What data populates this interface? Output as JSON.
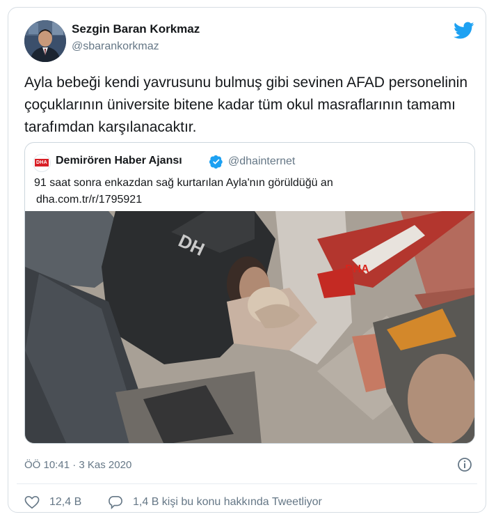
{
  "author": {
    "name": "Sezgin Baran Korkmaz",
    "handle": "@sbarankorkmaz"
  },
  "tweet": {
    "text": "Ayla bebeği kendi yavrusunu bulmuş gibi sevinen AFAD personelinin çoçuklarının üniversite bitene kadar tüm okul masraflarının tamamı tarafımdan karşılanacaktır."
  },
  "quoted": {
    "name": "Demirören Haber Ajansı",
    "handle": "@dhainternet",
    "logo_text": "DHA",
    "text": "91 saat sonra enkazdan sağ kurtarılan Ayla'nın görüldüğü an",
    "link": "dha.com.tr/r/1795921",
    "watermark": "DHA"
  },
  "meta": {
    "time": "ÖÖ 10:41",
    "separator": "·",
    "date": "3 Kas 2020"
  },
  "actions": {
    "likes": "12,4 B",
    "discussion": "1,4 B kişi bu konu hakkında Tweetliyor"
  },
  "icons": {
    "brand": "twitter-bird-icon",
    "verified": "verified-badge-icon",
    "info": "info-icon",
    "like": "heart-icon",
    "reply": "reply-bubble-icon"
  },
  "colors": {
    "twitter_blue": "#1da1f2",
    "text": "#14171a",
    "muted": "#657786",
    "dha_red": "#d81f26"
  }
}
